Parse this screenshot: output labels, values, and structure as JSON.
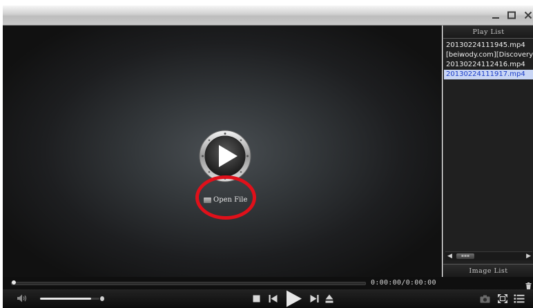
{
  "window": {
    "title": "",
    "buttons": {
      "minimize": "minimize",
      "maximize": "maximize",
      "close": "close"
    }
  },
  "player": {
    "open_file_label": "Open File",
    "play_icon": "play-circle-icon"
  },
  "playlist": {
    "header": "Play List",
    "items": [
      {
        "label": "20130224111945.mp4",
        "selected": false
      },
      {
        "label": "[beiwody.com][Discovery]",
        "selected": false
      },
      {
        "label": "20130224112416.mp4",
        "selected": false
      },
      {
        "label": "20130224111917.mp4",
        "selected": true
      }
    ],
    "image_list_label": "Image List"
  },
  "seek": {
    "time_display": "0:00:00/0:00:00",
    "position_fraction": 0.0
  },
  "volume": {
    "level_fraction": 0.86
  },
  "controls": {
    "icons": [
      "volume-icon",
      "stop-icon",
      "previous-icon",
      "play-icon",
      "next-icon",
      "eject-icon",
      "snapshot-icon",
      "fullscreen-icon",
      "playlist-icon"
    ]
  },
  "colors": {
    "selection_bg": "#c9d6f5",
    "selection_text": "#1a3cc8",
    "annotation": "#e0101a"
  }
}
